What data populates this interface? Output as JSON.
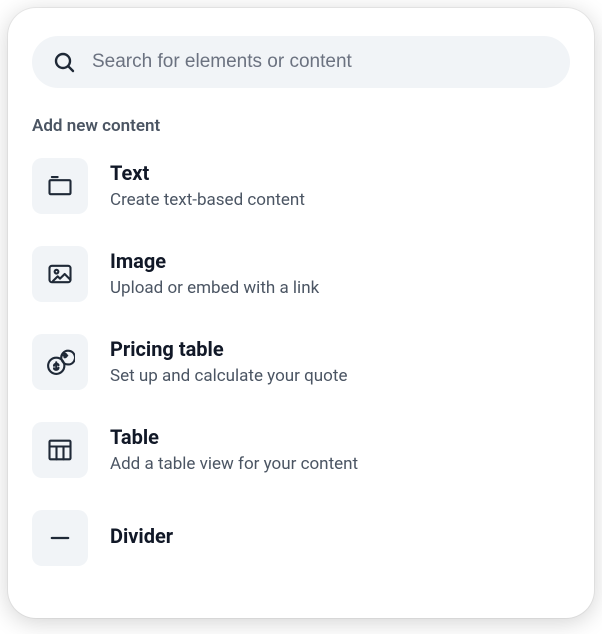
{
  "search": {
    "placeholder": "Search for elements or content"
  },
  "section_heading": "Add new content",
  "items": [
    {
      "title": "Text",
      "desc": "Create text-based content"
    },
    {
      "title": "Image",
      "desc": "Upload or embed with a link"
    },
    {
      "title": "Pricing table",
      "desc": "Set up and calculate your quote"
    },
    {
      "title": "Table",
      "desc": "Add a table view for your content"
    },
    {
      "title": "Divider",
      "desc": ""
    }
  ]
}
